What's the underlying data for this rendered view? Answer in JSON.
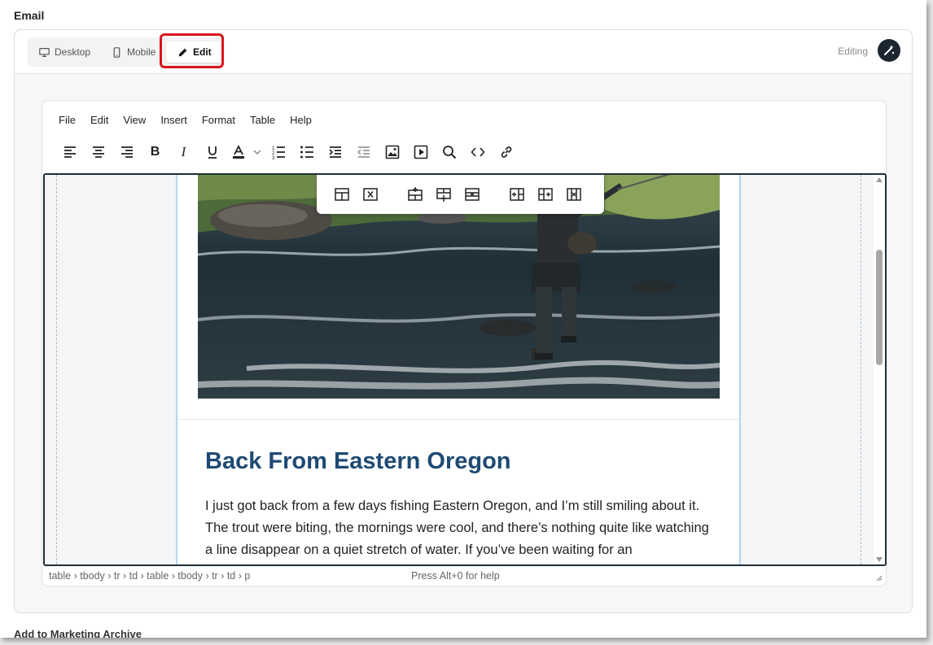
{
  "section": {
    "title": "Email"
  },
  "view_tabs": {
    "desktop": "Desktop",
    "mobile": "Mobile",
    "edit": "Edit"
  },
  "status": {
    "text": "Editing"
  },
  "menu": [
    "File",
    "Edit",
    "View",
    "Insert",
    "Format",
    "Table",
    "Help"
  ],
  "toolbar_icons": [
    "align-left-icon",
    "align-center-icon",
    "align-right-icon",
    "bold-icon",
    "italic-icon",
    "underline-icon",
    "text-color-icon",
    "text-color-dropdown-icon",
    "numbered-list-icon",
    "bullet-list-icon",
    "indent-icon",
    "outdent-icon",
    "image-icon",
    "media-icon",
    "search-icon",
    "source-code-icon",
    "link-icon"
  ],
  "table_toolbar_icons": [
    "table-properties-icon",
    "delete-table-icon",
    "insert-row-before-icon",
    "insert-row-after-icon",
    "delete-row-icon",
    "insert-column-before-icon",
    "insert-column-after-icon",
    "delete-column-icon"
  ],
  "article": {
    "title": "Back From Eastern Oregon",
    "body": "I just got back from a few days fishing Eastern Oregon, and I’m still smiling about it. The trout were biting, the mornings were cool, and there’s nothing quite like watching a line disappear on a quiet stretch of water. If you’ve been waiting for an"
  },
  "statusbar": {
    "path": "table › tbody › tr › td › table › tbody › tr › td › p",
    "help": "Press Alt+0 for help"
  },
  "footer": {
    "checkbox_label": "Add to Marketing Archive"
  },
  "colors": {
    "accent": "#d8141c",
    "title": "#1e4a73",
    "frame": "#1d2e3a"
  }
}
